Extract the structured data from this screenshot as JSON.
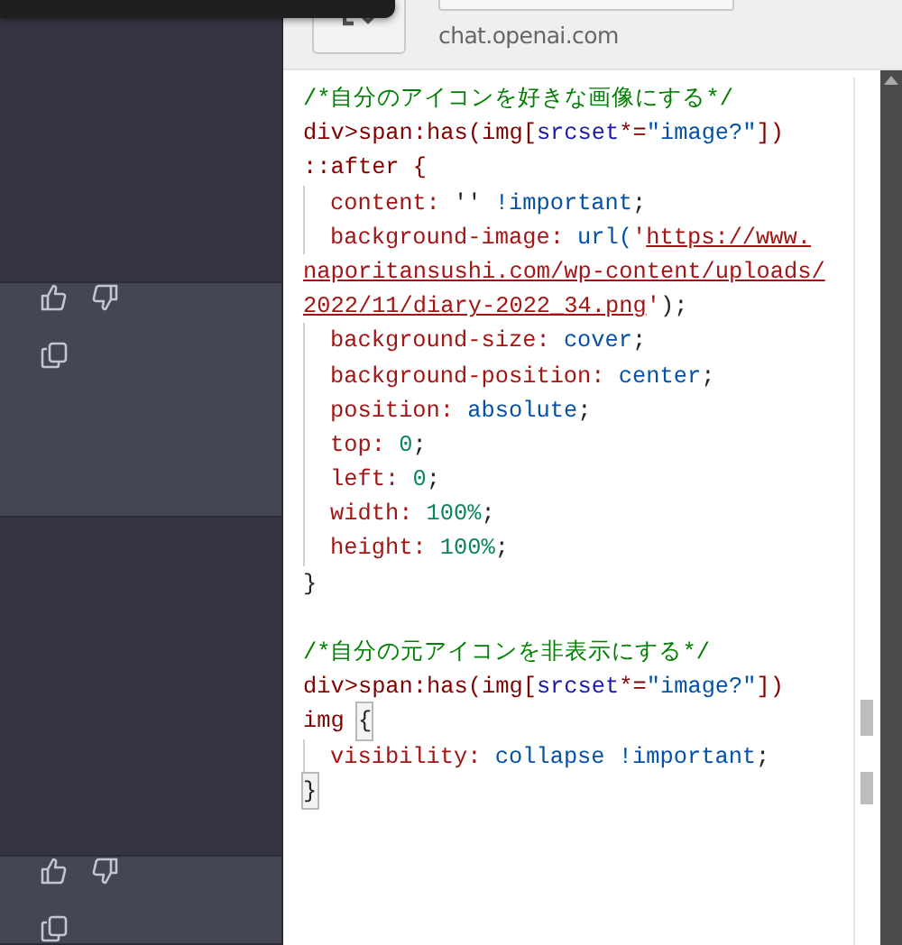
{
  "chat": {
    "messages": [
      {
        "kind": "user"
      },
      {
        "kind": "assistant"
      },
      {
        "kind": "user"
      },
      {
        "kind": "assistant"
      }
    ]
  },
  "header": {
    "address": "chat.openai.com"
  },
  "editor": {
    "lines": [
      {
        "indent": false,
        "tokens": [
          {
            "kind": "comment",
            "text": "/*自分のアイコンを好きな画像にする*/"
          }
        ]
      },
      {
        "indent": false,
        "tokens": [
          {
            "kind": "selector",
            "text": "div>span:has(img["
          },
          {
            "kind": "attr",
            "text": "srcset"
          },
          {
            "kind": "selector",
            "text": "*="
          },
          {
            "kind": "attrvalue",
            "text": "\"image?\""
          },
          {
            "kind": "selector",
            "text": "])"
          }
        ]
      },
      {
        "indent": false,
        "tokens": [
          {
            "kind": "selector",
            "text": "::after {"
          }
        ]
      },
      {
        "indent": true,
        "tokens": [
          {
            "kind": "prop",
            "text": "content:"
          },
          {
            "kind": "plain",
            "text": " '' "
          },
          {
            "kind": "value",
            "text": "!important"
          },
          {
            "kind": "plain",
            "text": ";"
          }
        ]
      },
      {
        "indent": true,
        "tokens": [
          {
            "kind": "prop",
            "text": "background-image:"
          },
          {
            "kind": "value",
            "text": " url("
          },
          {
            "kind": "string",
            "text": "'"
          },
          {
            "kind": "url",
            "text": "https://www."
          }
        ]
      },
      {
        "indent": false,
        "tokens": [
          {
            "kind": "url",
            "text": "naporitansushi.com/wp-content/uploads/"
          }
        ]
      },
      {
        "indent": false,
        "tokens": [
          {
            "kind": "url",
            "text": "2022/11/diary-2022_34.png"
          },
          {
            "kind": "string",
            "text": "'"
          },
          {
            "kind": "plain",
            "text": ");"
          }
        ]
      },
      {
        "indent": true,
        "tokens": [
          {
            "kind": "prop",
            "text": "background-size:"
          },
          {
            "kind": "value",
            "text": " cover"
          },
          {
            "kind": "plain",
            "text": ";"
          }
        ]
      },
      {
        "indent": true,
        "tokens": [
          {
            "kind": "prop",
            "text": "background-position:"
          },
          {
            "kind": "value",
            "text": " center"
          },
          {
            "kind": "plain",
            "text": ";"
          }
        ]
      },
      {
        "indent": true,
        "tokens": [
          {
            "kind": "prop",
            "text": "position:"
          },
          {
            "kind": "value",
            "text": " absolute"
          },
          {
            "kind": "plain",
            "text": ";"
          }
        ]
      },
      {
        "indent": true,
        "tokens": [
          {
            "kind": "prop",
            "text": "top:"
          },
          {
            "kind": "number",
            "text": " 0"
          },
          {
            "kind": "plain",
            "text": ";"
          }
        ]
      },
      {
        "indent": true,
        "tokens": [
          {
            "kind": "prop",
            "text": "left:"
          },
          {
            "kind": "number",
            "text": " 0"
          },
          {
            "kind": "plain",
            "text": ";"
          }
        ]
      },
      {
        "indent": true,
        "tokens": [
          {
            "kind": "prop",
            "text": "width:"
          },
          {
            "kind": "number",
            "text": " 100%"
          },
          {
            "kind": "plain",
            "text": ";"
          }
        ]
      },
      {
        "indent": true,
        "tokens": [
          {
            "kind": "prop",
            "text": "height:"
          },
          {
            "kind": "number",
            "text": " 100%"
          },
          {
            "kind": "plain",
            "text": ";"
          }
        ]
      },
      {
        "indent": false,
        "tokens": [
          {
            "kind": "plain",
            "text": "}"
          }
        ]
      },
      {
        "indent": false
      },
      {
        "indent": false,
        "tokens": [
          {
            "kind": "comment",
            "text": "/*自分の元アイコンを非表示にする*/"
          }
        ]
      },
      {
        "indent": false,
        "tokens": [
          {
            "kind": "selector",
            "text": "div>span:has(img["
          },
          {
            "kind": "attr",
            "text": "srcset"
          },
          {
            "kind": "selector",
            "text": "*="
          },
          {
            "kind": "attrvalue",
            "text": "\"image?\""
          },
          {
            "kind": "selector",
            "text": "])"
          }
        ]
      },
      {
        "indent": false,
        "tokens": [
          {
            "kind": "selector",
            "text": "img "
          },
          {
            "kind": "brace",
            "text": "{"
          }
        ]
      },
      {
        "indent": true,
        "tokens": [
          {
            "kind": "prop",
            "text": "visibility:"
          },
          {
            "kind": "value",
            "text": " collapse !important"
          },
          {
            "kind": "plain",
            "text": ";"
          }
        ]
      },
      {
        "indent": false,
        "tokens": [
          {
            "kind": "brace",
            "text": "}"
          }
        ]
      }
    ]
  }
}
